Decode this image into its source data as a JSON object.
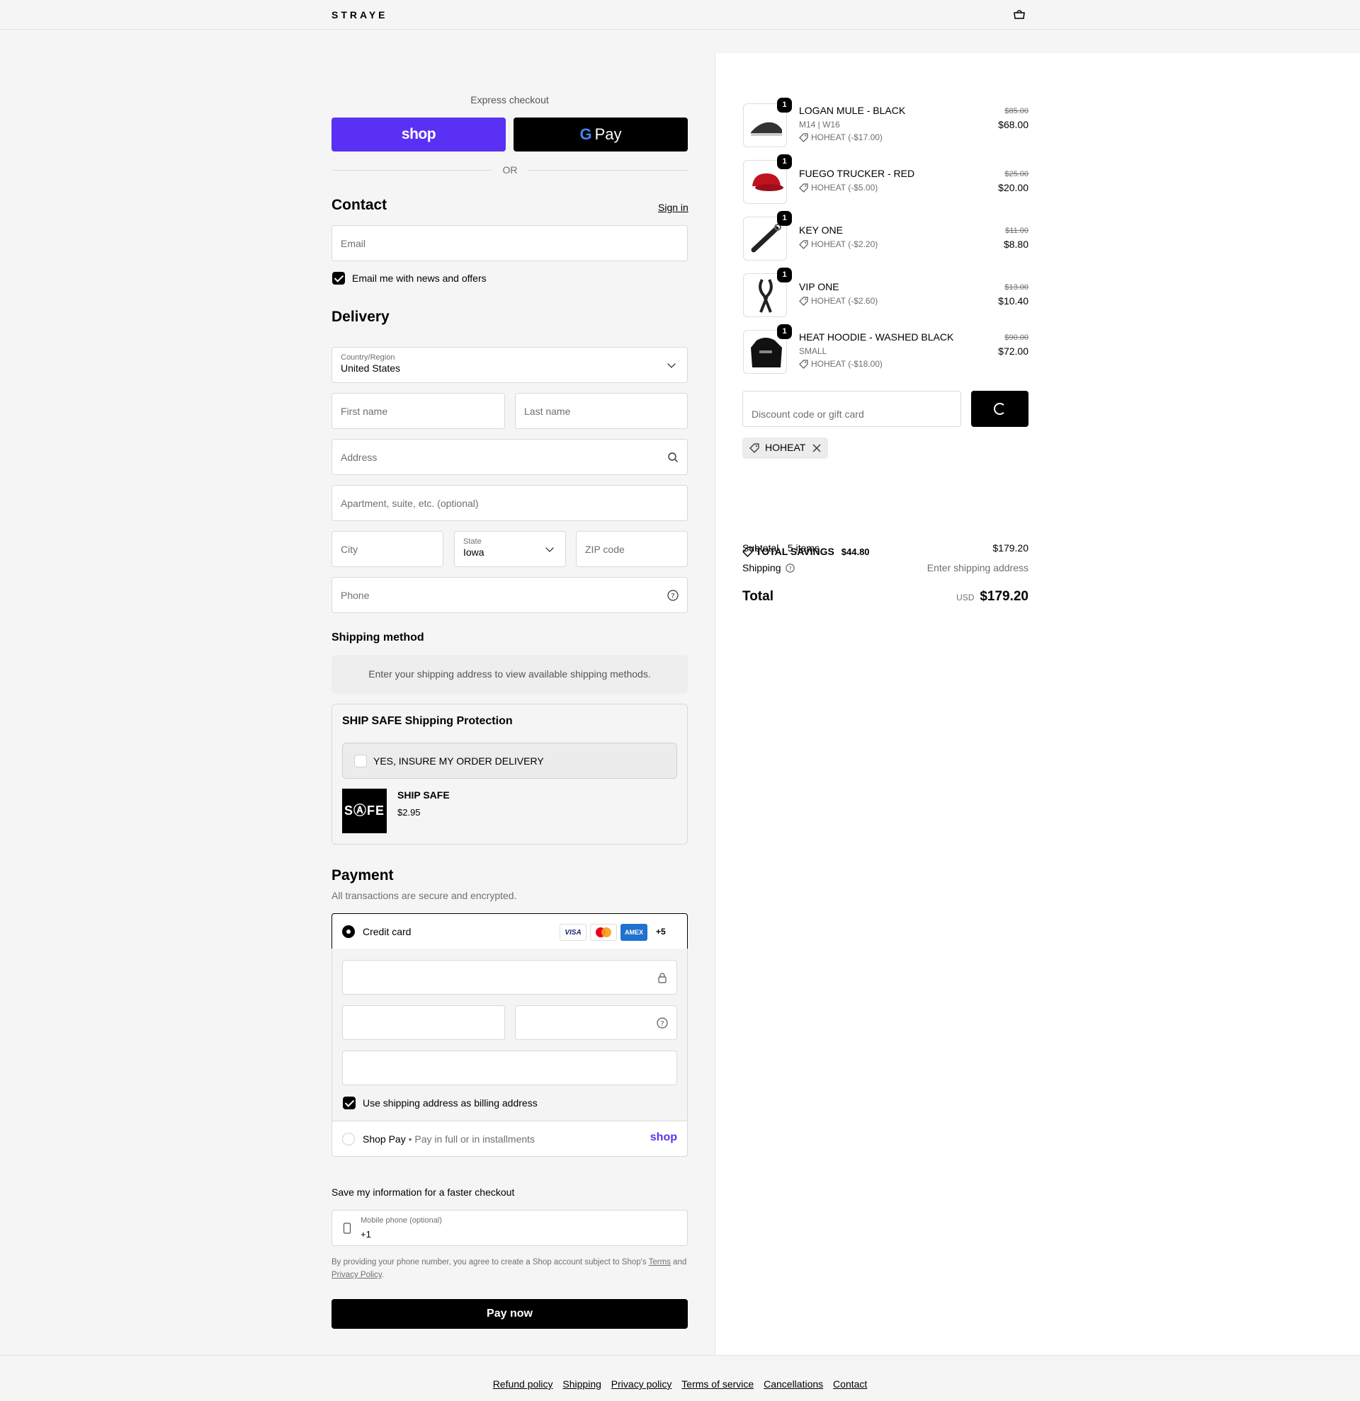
{
  "header": {
    "brand": "STRAYE"
  },
  "express": {
    "title": "Express checkout",
    "shop_label": "shop",
    "gpay_label": "Pay",
    "or_label": "OR"
  },
  "contact": {
    "title": "Contact",
    "sign_in": "Sign in",
    "email_placeholder": "Email",
    "newsletter_label": "Email me with news and offers",
    "newsletter_checked": true
  },
  "delivery": {
    "title": "Delivery",
    "country_label": "Country/Region",
    "country_value": "United States",
    "first_name": "First name",
    "last_name": "Last name",
    "address": "Address",
    "apartment": "Apartment, suite, etc. (optional)",
    "city": "City",
    "state_label": "State",
    "state_value": "Iowa",
    "zip": "ZIP code",
    "phone": "Phone"
  },
  "shipping_method": {
    "title": "Shipping method",
    "message": "Enter your shipping address to view available shipping methods."
  },
  "ship_safe": {
    "title": "SHIP SAFE Shipping Protection",
    "insure_label": "YES, INSURE MY ORDER DELIVERY",
    "logo_text": "SⒶFE",
    "product_name": "SHIP SAFE",
    "product_price": "$2.95"
  },
  "payment": {
    "title": "Payment",
    "subtitle": "All transactions are secure and encrypted.",
    "credit_card_label": "Credit card",
    "card_logos": [
      "VISA",
      "MC",
      "AMEX"
    ],
    "more_cards": "+5",
    "billing_label": "Use shipping address as billing address",
    "shop_pay_label": "Shop Pay",
    "shop_pay_sub": "Pay in full or in installments",
    "shop_pay_logo": "shop"
  },
  "save_info": {
    "title": "Save my information for a faster checkout",
    "mobile_label": "Mobile phone (optional)",
    "mobile_value": "+1",
    "disclaimer_pre": "By providing your phone number, you agree to create a Shop account subject to Shop's",
    "terms": "Terms",
    "and": "and",
    "privacy": "Privacy Policy",
    "period": "."
  },
  "pay_now": "Pay now",
  "cart": {
    "items": [
      {
        "name": "LOGAN MULE - BLACK",
        "variant": "M14 | W16",
        "discount": "HOHEAT (-$17.00)",
        "original": "$85.00",
        "price": "$68.00",
        "qty": "1"
      },
      {
        "name": "FUEGO TRUCKER - RED",
        "variant": "",
        "discount": "HOHEAT (-$5.00)",
        "original": "$25.00",
        "price": "$20.00",
        "qty": "1"
      },
      {
        "name": "KEY ONE",
        "variant": "",
        "discount": "HOHEAT (-$2.20)",
        "original": "$11.00",
        "price": "$8.80",
        "qty": "1"
      },
      {
        "name": "VIP ONE",
        "variant": "",
        "discount": "HOHEAT (-$2.60)",
        "original": "$13.00",
        "price": "$10.40",
        "qty": "1"
      },
      {
        "name": "HEAT HOODIE - WASHED BLACK",
        "variant": "SMALL",
        "discount": "HOHEAT (-$18.00)",
        "original": "$90.00",
        "price": "$72.00",
        "qty": "1"
      }
    ],
    "discount_placeholder": "Discount code or gift card",
    "applied_code": "HOHEAT",
    "subtotal_label": "Subtotal · 5 items",
    "subtotal_value": "$179.20",
    "savings_label": "TOTAL SAVINGS",
    "savings_value": "$44.80",
    "shipping_label": "Shipping",
    "shipping_value": "Enter shipping address",
    "total_label": "Total",
    "currency": "USD",
    "total_value": "$179.20"
  },
  "footer": {
    "links": [
      "Refund policy",
      "Shipping",
      "Privacy policy",
      "Terms of service",
      "Cancellations",
      "Contact"
    ]
  },
  "colors": {
    "shop_purple": "#5a31f4",
    "black": "#000000",
    "muted": "#707070"
  }
}
